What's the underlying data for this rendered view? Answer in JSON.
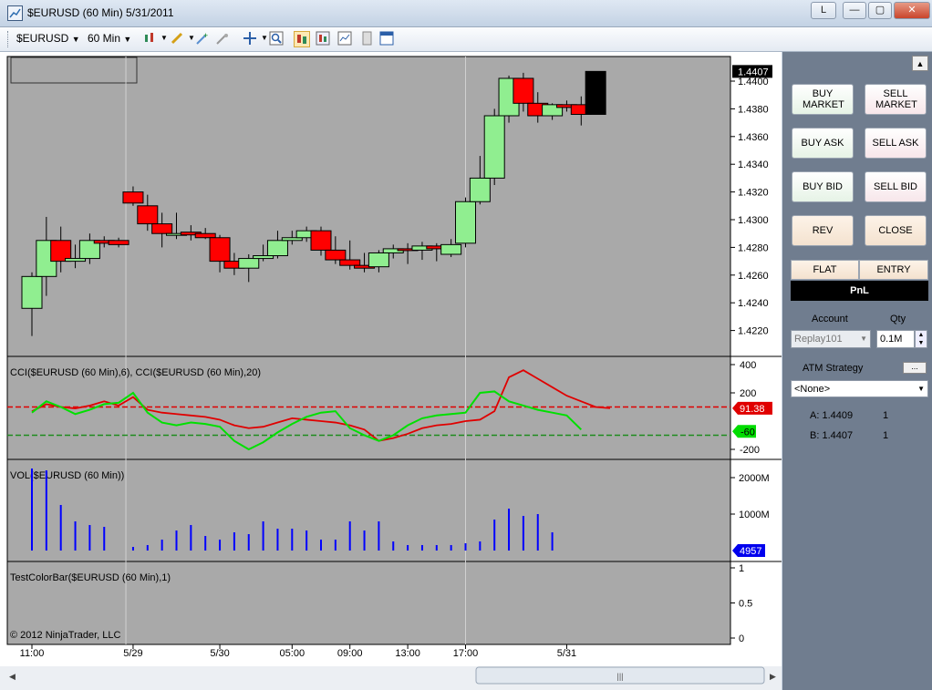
{
  "window": {
    "title": "$EURUSD (60 Min)  5/31/2011",
    "link_button": "L",
    "minimize_glyph": "—",
    "maximize_glyph": "▢",
    "close_glyph": "✕"
  },
  "toolbar": {
    "instrument": "$EURUSD",
    "interval": "60 Min"
  },
  "chart": {
    "copyright": "© 2012 NinjaTrader, LLC",
    "price_axis": {
      "ticks": [
        "1.4400",
        "1.4380",
        "1.4360",
        "1.4340",
        "1.4320",
        "1.4300",
        "1.4280",
        "1.4260",
        "1.4240",
        "1.4220"
      ],
      "tick_values": [
        1.44,
        1.438,
        1.436,
        1.434,
        1.432,
        1.43,
        1.428,
        1.426,
        1.424,
        1.422
      ],
      "last_price_label": "1.4407",
      "last_price": 1.4407
    },
    "candles": [
      {
        "o": 1.4236,
        "h": 1.4262,
        "l": 1.4216,
        "c": 1.4259
      },
      {
        "o": 1.4259,
        "h": 1.4302,
        "l": 1.4245,
        "c": 1.4285
      },
      {
        "o": 1.4285,
        "h": 1.4295,
        "l": 1.4262,
        "c": 1.427
      },
      {
        "o": 1.427,
        "h": 1.4282,
        "l": 1.4265,
        "c": 1.4272
      },
      {
        "o": 1.4272,
        "h": 1.429,
        "l": 1.4268,
        "c": 1.4285
      },
      {
        "o": 1.4285,
        "h": 1.4288,
        "l": 1.428,
        "c": 1.4283
      },
      {
        "o": 1.4285,
        "h": 1.4287,
        "l": 1.428,
        "c": 1.4282
      },
      {
        "o": 1.432,
        "h": 1.4324,
        "l": 1.431,
        "c": 1.4312
      },
      {
        "o": 1.431,
        "h": 1.4318,
        "l": 1.4292,
        "c": 1.4297
      },
      {
        "o": 1.4297,
        "h": 1.4305,
        "l": 1.428,
        "c": 1.429
      },
      {
        "o": 1.429,
        "h": 1.4305,
        "l": 1.4286,
        "c": 1.429
      },
      {
        "o": 1.4291,
        "h": 1.4296,
        "l": 1.4285,
        "c": 1.4289
      },
      {
        "o": 1.429,
        "h": 1.4294,
        "l": 1.4286,
        "c": 1.4287
      },
      {
        "o": 1.4287,
        "h": 1.4289,
        "l": 1.4262,
        "c": 1.427
      },
      {
        "o": 1.427,
        "h": 1.4276,
        "l": 1.426,
        "c": 1.4265
      },
      {
        "o": 1.4265,
        "h": 1.4275,
        "l": 1.4255,
        "c": 1.4272
      },
      {
        "o": 1.4272,
        "h": 1.4282,
        "l": 1.427,
        "c": 1.4274
      },
      {
        "o": 1.4274,
        "h": 1.4292,
        "l": 1.4272,
        "c": 1.4285
      },
      {
        "o": 1.4285,
        "h": 1.4292,
        "l": 1.4282,
        "c": 1.4287
      },
      {
        "o": 1.4287,
        "h": 1.4295,
        "l": 1.4284,
        "c": 1.4292
      },
      {
        "o": 1.4292,
        "h": 1.4295,
        "l": 1.4274,
        "c": 1.4278
      },
      {
        "o": 1.4278,
        "h": 1.4288,
        "l": 1.4268,
        "c": 1.4271
      },
      {
        "o": 1.4271,
        "h": 1.4285,
        "l": 1.4264,
        "c": 1.4267
      },
      {
        "o": 1.4267,
        "h": 1.4276,
        "l": 1.4262,
        "c": 1.4265
      },
      {
        "o": 1.4266,
        "h": 1.4278,
        "l": 1.4262,
        "c": 1.4276
      },
      {
        "o": 1.4276,
        "h": 1.4282,
        "l": 1.4272,
        "c": 1.4279
      },
      {
        "o": 1.4279,
        "h": 1.4283,
        "l": 1.4268,
        "c": 1.4278
      },
      {
        "o": 1.4278,
        "h": 1.4284,
        "l": 1.4271,
        "c": 1.4281
      },
      {
        "o": 1.4281,
        "h": 1.4283,
        "l": 1.427,
        "c": 1.4279
      },
      {
        "o": 1.4275,
        "h": 1.4286,
        "l": 1.4273,
        "c": 1.4282
      },
      {
        "o": 1.4283,
        "h": 1.4316,
        "l": 1.428,
        "c": 1.4313
      },
      {
        "o": 1.4313,
        "h": 1.4346,
        "l": 1.4311,
        "c": 1.433
      },
      {
        "o": 1.433,
        "h": 1.438,
        "l": 1.4325,
        "c": 1.4375
      },
      {
        "o": 1.4375,
        "h": 1.4404,
        "l": 1.437,
        "c": 1.4402
      },
      {
        "o": 1.4402,
        "h": 1.4406,
        "l": 1.4378,
        "c": 1.4384
      },
      {
        "o": 1.4384,
        "h": 1.4392,
        "l": 1.437,
        "c": 1.4375
      },
      {
        "o": 1.4375,
        "h": 1.4384,
        "l": 1.4372,
        "c": 1.4383
      },
      {
        "o": 1.4383,
        "h": 1.4386,
        "l": 1.4378,
        "c": 1.4381
      },
      {
        "o": 1.4383,
        "h": 1.4389,
        "l": 1.4368,
        "c": 1.4376
      },
      {
        "o": 1.4376,
        "h": 1.4407,
        "l": 1.4376,
        "c": 1.4407
      }
    ],
    "x_labels": [
      {
        "text": "11:00",
        "bar": 0
      },
      {
        "text": "5/29",
        "bar": 7
      },
      {
        "text": "5/30",
        "bar": 13
      },
      {
        "text": "05:00",
        "bar": 18
      },
      {
        "text": "09:00",
        "bar": 22
      },
      {
        "text": "13:00",
        "bar": 26
      },
      {
        "text": "17:00",
        "bar": 30
      },
      {
        "text": "5/31",
        "bar": 37
      }
    ],
    "session_lines_bars": [
      6.5,
      30
    ]
  },
  "cci_panel": {
    "label": "CCI($EURUSD (60 Min),6), CCI($EURUSD (60 Min),20)",
    "axis_ticks": [
      "400",
      "200",
      "-200"
    ],
    "axis_values": [
      400,
      200,
      -200
    ],
    "fast_label": "-60",
    "slow_label": "91.38",
    "upper_level": 100,
    "lower_level": -100,
    "fast_values": [
      60,
      140,
      100,
      50,
      80,
      120,
      130,
      200,
      60,
      -10,
      -30,
      -10,
      -20,
      -40,
      -140,
      -200,
      -150,
      -80,
      -20,
      30,
      60,
      70,
      -50,
      -100,
      -140,
      -100,
      -30,
      20,
      40,
      50,
      60,
      200,
      210,
      140,
      110,
      80,
      60,
      40,
      -60
    ],
    "slow_values": [
      70,
      120,
      100,
      90,
      110,
      140,
      110,
      170,
      80,
      60,
      50,
      40,
      30,
      10,
      -30,
      -50,
      -40,
      -10,
      20,
      10,
      0,
      -10,
      -30,
      -60,
      -140,
      -120,
      -90,
      -50,
      -30,
      -20,
      0,
      10,
      70,
      310,
      360,
      300,
      240,
      180,
      140,
      100,
      91.38
    ]
  },
  "volume_panel": {
    "label": "VOL($EURUSD (60 Min))",
    "axis_ticks": [
      "2000M",
      "1000M"
    ],
    "axis_values": [
      2000,
      1000
    ],
    "last_label": "4957",
    "values": [
      2250,
      2200,
      1250,
      800,
      700,
      650,
      0,
      100,
      150,
      300,
      550,
      700,
      400,
      300,
      500,
      450,
      800,
      600,
      600,
      550,
      300,
      300,
      800,
      550,
      800,
      250,
      150,
      150,
      150,
      150,
      200,
      250,
      850,
      1150,
      950,
      1000,
      500
    ]
  },
  "testcolor_panel": {
    "label": "TestColorBar($EURUSD (60 Min),1)",
    "axis_ticks": [
      "1",
      "0.5",
      "0"
    ],
    "axis_values": [
      1,
      0.5,
      0
    ]
  },
  "order_panel": {
    "buy_market": "BUY MARKET",
    "sell_market": "SELL MARKET",
    "buy_ask": "BUY ASK",
    "sell_ask": "SELL ASK",
    "buy_bid": "BUY BID",
    "sell_bid": "SELL BID",
    "rev": "REV",
    "close": "CLOSE",
    "flat": "FLAT",
    "entry": "ENTRY",
    "pnl": "PnL",
    "account_label": "Account",
    "qty_label": "Qty",
    "account_value": "Replay101",
    "qty_value": "0.1M",
    "atm_label": "ATM Strategy",
    "atm_value": "<None>",
    "ask_label": "A: 1.4409",
    "ask_qty": "1",
    "bid_label": "B: 1.4407",
    "bid_qty": "1"
  },
  "colors": {
    "up_candle": "#90ee90",
    "down_candle": "#ff0000",
    "last_candle": "#000000",
    "chart_bg": "#a9a9a9",
    "cci_fast": "#00e000",
    "cci_slow": "#e00000",
    "volume": "#0000ff",
    "panel_bg": "#707d8f"
  }
}
